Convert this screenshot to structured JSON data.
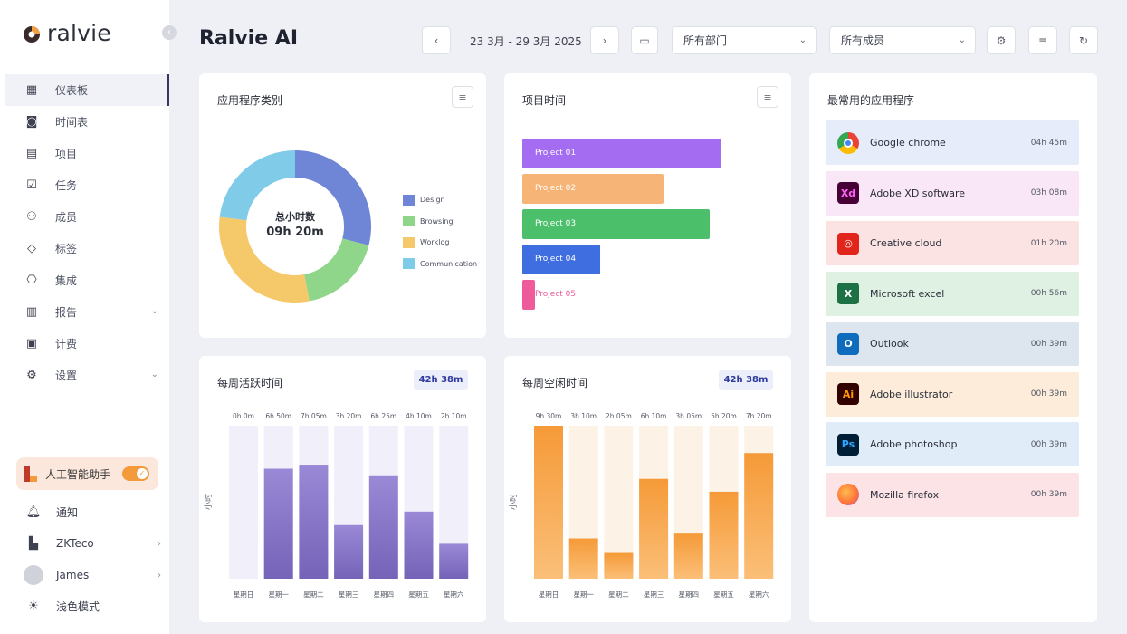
{
  "app": {
    "logo_text": "ralvie",
    "title": "Ralvie AI"
  },
  "sidebar": {
    "items": [
      {
        "label": "仪表板",
        "icon": "dashboard-icon",
        "active": true
      },
      {
        "label": "时间表",
        "icon": "timesheet-icon"
      },
      {
        "label": "项目",
        "icon": "project-icon"
      },
      {
        "label": "任务",
        "icon": "task-icon"
      },
      {
        "label": "成员",
        "icon": "members-icon"
      },
      {
        "label": "标签",
        "icon": "tag-icon"
      },
      {
        "label": "集成",
        "icon": "integration-icon"
      },
      {
        "label": "报告",
        "icon": "report-icon",
        "chevron": true
      },
      {
        "label": "计费",
        "icon": "billing-icon"
      },
      {
        "label": "设置",
        "icon": "settings-icon",
        "chevron": true
      }
    ],
    "ai_assistant": {
      "label": "人工智能助手",
      "enabled": true
    },
    "notifications": "通知",
    "company": "ZKTeco",
    "user": "James",
    "theme": "浅色模式"
  },
  "toolbar": {
    "date_range": "23 3月 - 29 3月 2025",
    "department": "所有部门",
    "member": "所有成员"
  },
  "app_categories": {
    "title": "应用程序类别",
    "center_label": "总小时数",
    "center_value": "09h 20m",
    "chart_data": {
      "type": "pie",
      "categories": [
        "Design",
        "Browsing",
        "Worklog",
        "Communication"
      ],
      "values": [
        29,
        18,
        30,
        23
      ],
      "colors": [
        "#6f86d6",
        "#8fd68a",
        "#f5c86a",
        "#7fcbe8"
      ]
    }
  },
  "project_time": {
    "title": "项目时间",
    "chart_data": {
      "type": "bar",
      "orientation": "horizontal",
      "categories": [
        "Project 01",
        "Project 02",
        "Project 03",
        "Project 04",
        "Project 05"
      ],
      "values": [
        100,
        71,
        94,
        39,
        3
      ],
      "colors": [
        "#a46cf0",
        "#f7b477",
        "#4cbf6a",
        "#3f6ee0",
        "#ee5a9a"
      ]
    }
  },
  "weekly_active": {
    "title": "每周活跃时间",
    "total": "42h 38m",
    "ylabel": "小时",
    "chart_data": {
      "type": "bar",
      "categories": [
        "星期日",
        "星期一",
        "星期二",
        "星期三",
        "星期四",
        "星期五",
        "星期六"
      ],
      "labels": [
        "0h 0m",
        "6h 50m",
        "7h 05m",
        "3h 20m",
        "6h 25m",
        "4h 10m",
        "2h 10m"
      ],
      "values": [
        0,
        6.83,
        7.08,
        3.33,
        6.42,
        4.17,
        2.17
      ],
      "ylim": [
        0,
        9.5
      ]
    }
  },
  "weekly_idle": {
    "title": "每周空闲时间",
    "total": "42h 38m",
    "ylabel": "小时",
    "chart_data": {
      "type": "bar",
      "categories": [
        "星期日",
        "星期一",
        "星期二",
        "星期三",
        "星期四",
        "星期五",
        "星期六"
      ],
      "labels": [
        "9h 30m",
        "3h 10m",
        "2h 05m",
        "6h 10m",
        "3h 05m",
        "5h 20m",
        "7h 20m"
      ],
      "values": [
        9.5,
        2.5,
        1.6,
        6.2,
        2.8,
        5.4,
        7.8
      ],
      "ylim": [
        0,
        9.5
      ]
    }
  },
  "top_apps": {
    "title": "最常用的应用程序",
    "items": [
      {
        "name": "Google chrome",
        "time": "04h 45m",
        "bg": "#e6ecfa",
        "icon": "chrome-icon",
        "glyph": "",
        "color": "#ea4335"
      },
      {
        "name": "Adobe XD software",
        "time": "03h 08m",
        "bg": "#f9e6f7",
        "icon": "adobe-xd-icon",
        "glyph": "Xd",
        "color": "#470137"
      },
      {
        "name": "Creative cloud",
        "time": "01h 20m",
        "bg": "#fbe3e3",
        "icon": "creative-cloud-icon",
        "glyph": "◎",
        "color": "#e1251b"
      },
      {
        "name": "Microsoft excel",
        "time": "00h 56m",
        "bg": "#dff1e3",
        "icon": "excel-icon",
        "glyph": "X",
        "color": "#1e7145"
      },
      {
        "name": "Outlook",
        "time": "00h 39m",
        "bg": "#dde6ef",
        "icon": "outlook-icon",
        "glyph": "O",
        "color": "#0f6cbd"
      },
      {
        "name": "Adobe illustrator",
        "time": "00h 39m",
        "bg": "#fcecd9",
        "icon": "illustrator-icon",
        "glyph": "Ai",
        "color": "#330000"
      },
      {
        "name": "Adobe photoshop",
        "time": "00h 39m",
        "bg": "#e1ecf9",
        "icon": "photoshop-icon",
        "glyph": "Ps",
        "color": "#001e36"
      },
      {
        "name": "Mozilla firefox",
        "time": "00h 39m",
        "bg": "#fbe3e6",
        "icon": "firefox-icon",
        "glyph": "",
        "color": "#ff7139"
      }
    ]
  }
}
